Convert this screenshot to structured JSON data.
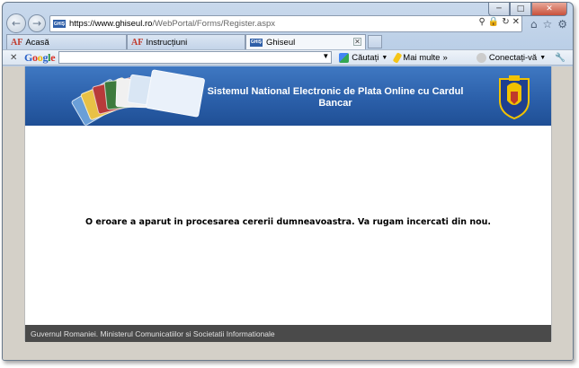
{
  "browser": {
    "url_prefix": "https://www.ghiseul.ro",
    "url_path": "/WebPortal/Forms/Register.aspx",
    "favicon_text": "GHIŞ",
    "tabs": [
      {
        "label": "Acasă"
      },
      {
        "label": "Instrucțiuni"
      },
      {
        "label": "Ghiseul"
      }
    ]
  },
  "google_toolbar": {
    "logo": "Google",
    "search_value": "",
    "search_button": "Căutați",
    "more_button": "Mai multe",
    "signin": "Conectați-vă"
  },
  "page": {
    "banner_title": "Sistemul National Electronic de Plata Online cu Cardul Bancar",
    "error_message": "O eroare a aparut in procesarea cererii dumneavoastra. Va rugam incercati din nou.",
    "footer": "Guvernul Romaniei. Ministerul Comunicatiilor si Societatii Informationale"
  },
  "icons": {
    "back": "back-arrow-icon",
    "forward": "forward-arrow-icon",
    "search": "search-icon",
    "lock": "lock-icon",
    "refresh": "refresh-icon",
    "stop": "stop-icon",
    "home": "home-icon",
    "favorites": "star-icon",
    "tools": "gear-icon"
  },
  "colors": {
    "banner": "#2a5ea8",
    "footer": "#4a4a4a",
    "viewport_bg": "#d4d0c8"
  }
}
